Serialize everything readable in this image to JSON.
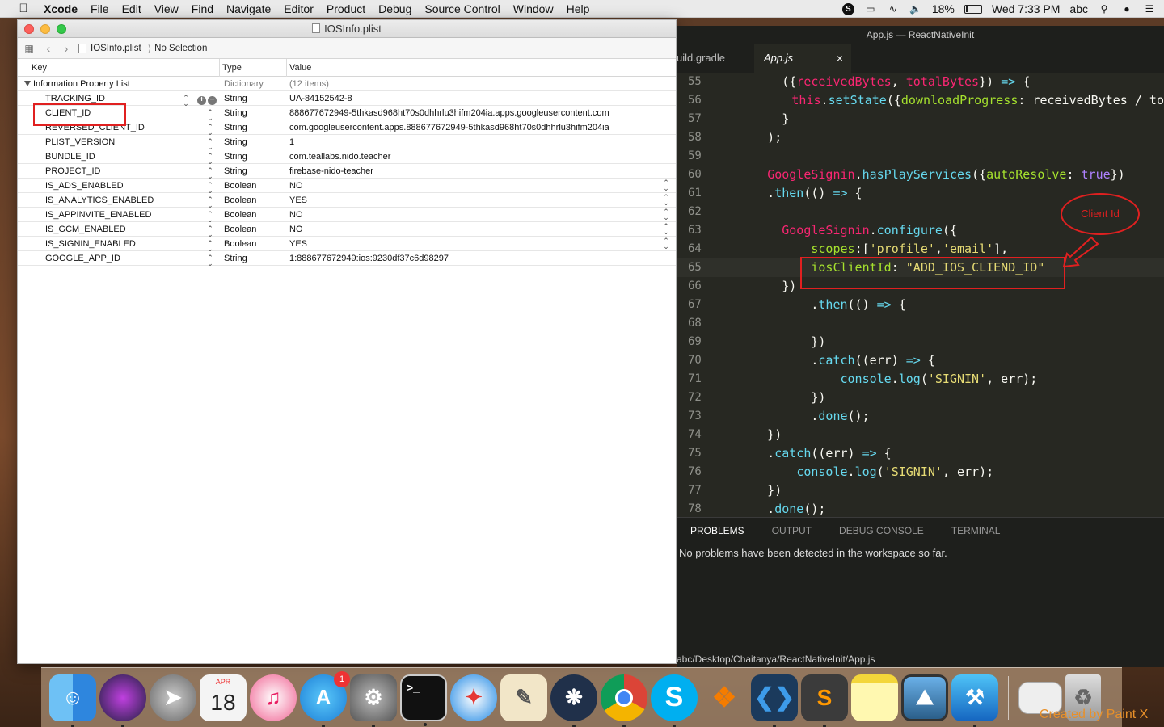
{
  "menubar": {
    "app_name": "Xcode",
    "items": [
      "File",
      "Edit",
      "View",
      "Find",
      "Navigate",
      "Editor",
      "Product",
      "Debug",
      "Source Control",
      "Window",
      "Help"
    ],
    "battery": "18%",
    "clock": "Wed 7:33 PM",
    "user": "abc"
  },
  "xcode": {
    "title": "IOSInfo.plist",
    "jumpbar": {
      "file": "IOSInfo.plist",
      "selection": "No Selection"
    },
    "columns": {
      "key": "Key",
      "type": "Type",
      "value": "Value"
    },
    "root": {
      "key": "Information Property List",
      "type": "Dictionary",
      "value": "(12 items)"
    },
    "rows": [
      {
        "key": "TRACKING_ID",
        "type": "String",
        "value": "UA-84152542-8"
      },
      {
        "key": "CLIENT_ID",
        "type": "String",
        "value": "888677672949-5thkasd968ht70s0dhhrlu3hifm204ia.apps.googleusercontent.com"
      },
      {
        "key": "REVERSED_CLIENT_ID",
        "type": "String",
        "value": "com.googleusercontent.apps.888677672949-5thkasd968ht70s0dhhrlu3hifm204ia"
      },
      {
        "key": "PLIST_VERSION",
        "type": "String",
        "value": "1"
      },
      {
        "key": "BUNDLE_ID",
        "type": "String",
        "value": "com.teallabs.nido.teacher"
      },
      {
        "key": "PROJECT_ID",
        "type": "String",
        "value": "firebase-nido-teacher"
      },
      {
        "key": "IS_ADS_ENABLED",
        "type": "Boolean",
        "value": "NO"
      },
      {
        "key": "IS_ANALYTICS_ENABLED",
        "type": "Boolean",
        "value": "YES"
      },
      {
        "key": "IS_APPINVITE_ENABLED",
        "type": "Boolean",
        "value": "NO"
      },
      {
        "key": "IS_GCM_ENABLED",
        "type": "Boolean",
        "value": "NO"
      },
      {
        "key": "IS_SIGNIN_ENABLED",
        "type": "Boolean",
        "value": "YES"
      },
      {
        "key": "GOOGLE_APP_ID",
        "type": "String",
        "value": "1:888677672949:ios:9230df37c6d98297"
      }
    ]
  },
  "vscode": {
    "title": "App.js — ReactNativeInit",
    "tabs": [
      {
        "label": "uild.gradle"
      },
      {
        "label": "App.js",
        "close": "×"
      }
    ],
    "line_numbers": [
      "55",
      "56",
      "57",
      "58",
      "59",
      "60",
      "61",
      "62",
      "63",
      "64",
      "65",
      "66",
      "67",
      "68",
      "69",
      "70",
      "71",
      "72",
      "73",
      "74",
      "75",
      "76",
      "77",
      "78"
    ],
    "panel_tabs": [
      "PROBLEMS",
      "OUTPUT",
      "DEBUG CONSOLE",
      "TERMINAL"
    ],
    "panel_message": "No problems have been detected in the workspace so far.",
    "status_path": "abc/Desktop/Chaitanya/ReactNativeInit/App.js"
  },
  "annotation": {
    "label": "Client Id"
  },
  "dock": {
    "calendar_month": "APR",
    "calendar_day": "18",
    "appstore_badge": "1",
    "terminal_glyph": ">_"
  },
  "watermark": "Created by Paint X"
}
